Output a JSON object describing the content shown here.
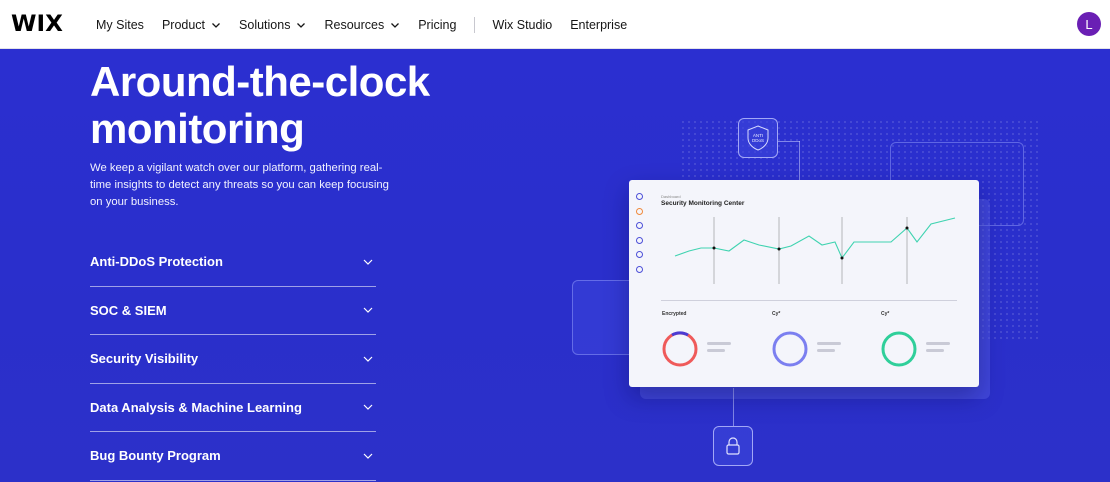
{
  "nav": {
    "logo": "WIX",
    "items": [
      {
        "label": "My Sites",
        "dropdown": false
      },
      {
        "label": "Product",
        "dropdown": true
      },
      {
        "label": "Solutions",
        "dropdown": true
      },
      {
        "label": "Resources",
        "dropdown": true
      },
      {
        "label": "Pricing",
        "dropdown": false
      }
    ],
    "secondary": [
      {
        "label": "Wix Studio"
      },
      {
        "label": "Enterprise"
      }
    ],
    "avatar_initial": "L",
    "avatar_color": "#6a1fb4"
  },
  "hero": {
    "title": "Around-the-clock\nmonitoring",
    "description": "We keep a vigilant watch over our platform, gathering real-time insights to detect any threats so you can keep focusing on your business.",
    "background": "#2b2fcc"
  },
  "accordion": [
    {
      "label": "Anti-DDoS Protection"
    },
    {
      "label": "SOC & SIEM"
    },
    {
      "label": "Security Visibility"
    },
    {
      "label": "Data Analysis & Machine Learning"
    },
    {
      "label": "Bug Bounty Program"
    }
  ],
  "illustration": {
    "shield_text": "ANTI DDoS",
    "dashboard_kicker": "Dashboard",
    "dashboard_title": "Security Monitoring Center",
    "metrics": [
      {
        "label": "Encrypted",
        "color": "#ef5a5a"
      },
      {
        "label": "Cy*",
        "color": "#7b7ff0"
      },
      {
        "label": "Cy*",
        "color": "#2fcf9a"
      }
    ],
    "line_color": "#3fd3b0"
  }
}
